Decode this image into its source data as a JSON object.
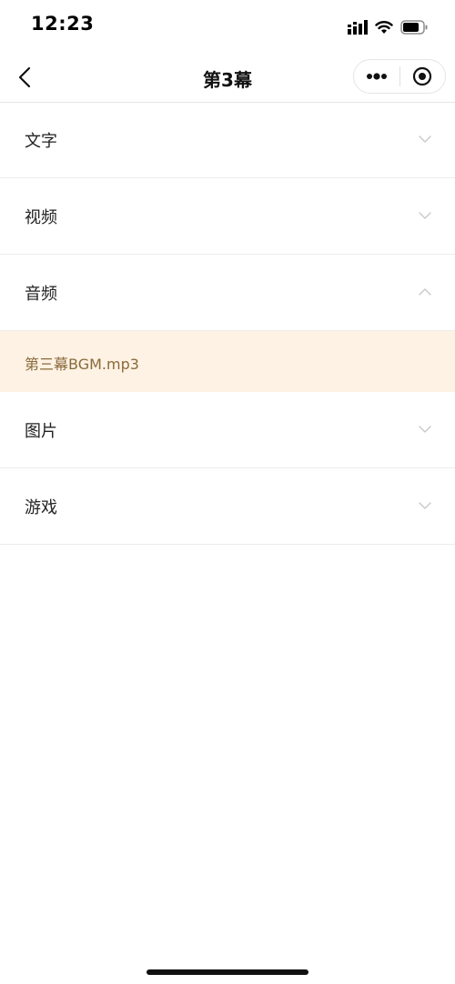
{
  "status_bar": {
    "time": "12:23"
  },
  "nav": {
    "title": "第3幕"
  },
  "sections": [
    {
      "label": "文字",
      "expanded": false,
      "items": []
    },
    {
      "label": "视频",
      "expanded": false,
      "items": []
    },
    {
      "label": "音频",
      "expanded": true,
      "items": [
        "第三幕BGM.mp3"
      ]
    },
    {
      "label": "图片",
      "expanded": false,
      "items": []
    },
    {
      "label": "游戏",
      "expanded": false,
      "items": []
    }
  ],
  "colors": {
    "highlight_bg": "#fdf2e3",
    "highlight_text": "#8a6a3c",
    "chevron": "#cccccc"
  }
}
